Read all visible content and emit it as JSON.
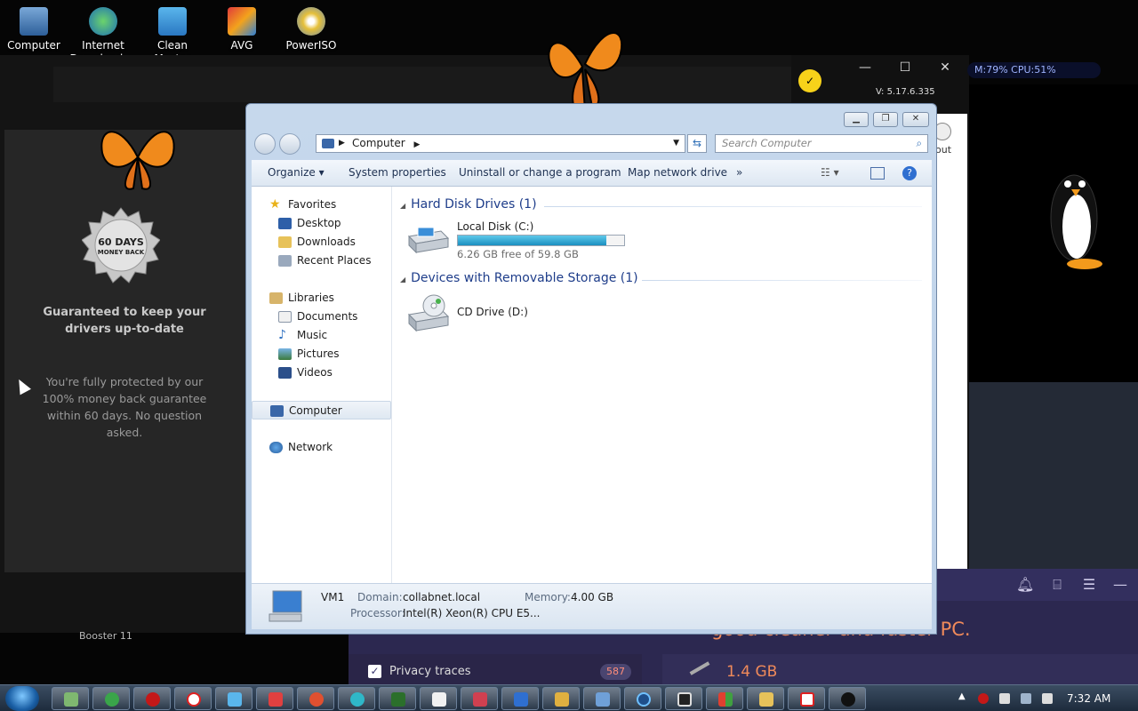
{
  "desktop": {
    "icons": [
      {
        "label": "Computer"
      },
      {
        "label": "Internet Download ..."
      },
      {
        "label": "Clean Master"
      },
      {
        "label": "AVG"
      },
      {
        "label": "PowerISO"
      }
    ]
  },
  "background_app": {
    "guarantee_title": "Guaranteed to keep your drivers up-to-date",
    "guarantee_text": "You're fully protected by our 100% money back guarantee within 60 days. No question asked.",
    "seal_days": "60 DAYS",
    "seal_money": "MONEY BACK",
    "booster_label": "Booster 11"
  },
  "overlay": {
    "version": "V: 5.17.6.335",
    "logout": "out",
    "sysmon": "M:79%  CPU:51%",
    "minimize_glyph": "—",
    "maximize_glyph": "☐",
    "close_glyph": "✕"
  },
  "purple_app": {
    "headline": "good cleaner and faster PC.",
    "privacy_label": "Privacy traces",
    "privacy_count": "587",
    "size": "1.4 GB"
  },
  "explorer": {
    "breadcrumb": "Computer",
    "search_placeholder": "Search Computer",
    "toolbar": {
      "organize": "Organize",
      "system_properties": "System properties",
      "uninstall": "Uninstall or change a program",
      "map_drive": "Map network drive",
      "more": "»"
    },
    "nav": {
      "favorites": "Favorites",
      "desktop": "Desktop",
      "downloads": "Downloads",
      "recent_places": "Recent Places",
      "libraries": "Libraries",
      "documents": "Documents",
      "music": "Music",
      "pictures": "Pictures",
      "videos": "Videos",
      "computer": "Computer",
      "network": "Network"
    },
    "groups": {
      "hdd": "Hard Disk Drives (1)",
      "removable": "Devices with Removable Storage (1)"
    },
    "drives": {
      "c_name": "Local Disk (C:)",
      "c_free": "6.26 GB free of 59.8 GB",
      "c_used_fraction": 0.895,
      "d_name": "CD Drive (D:)"
    },
    "details": {
      "name": "VM1",
      "domain_label": "Domain:",
      "domain_value": "collabnet.local",
      "memory_label": "Memory:",
      "memory_value": "4.00 GB",
      "processor_label": "Processor:",
      "processor_value": "Intel(R) Xeon(R) CPU E5..."
    }
  },
  "taskbar": {
    "clock": "7:32 AM"
  },
  "colors": {
    "accent_blue": "#1e3d8a",
    "capacity_fill": "#1b8fc0",
    "purple_bg": "#2c2850",
    "orange_text": "#f08a5a"
  }
}
